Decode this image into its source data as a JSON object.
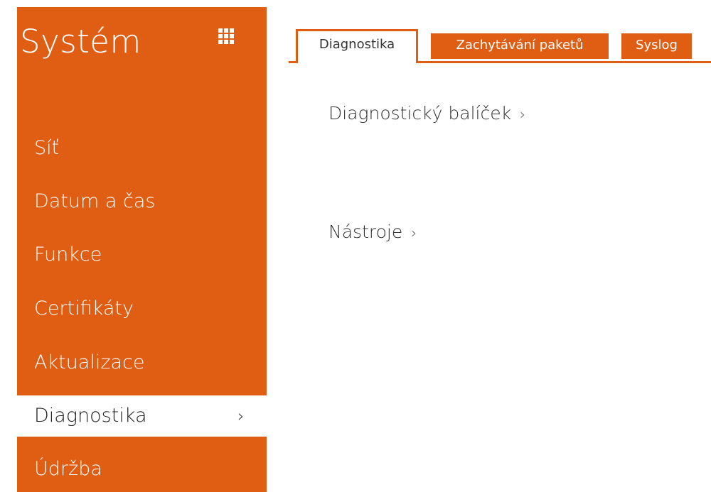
{
  "sidebar": {
    "title": "Systém",
    "items": [
      {
        "label": "Síť"
      },
      {
        "label": "Datum a čas"
      },
      {
        "label": "Funkce"
      },
      {
        "label": "Certifikáty"
      },
      {
        "label": "Aktualizace"
      },
      {
        "label": "Diagnostika",
        "chevron": "›"
      },
      {
        "label": "Údržba"
      }
    ]
  },
  "tabs": [
    {
      "label": "Diagnostika"
    },
    {
      "label": "Zachytávání paketů"
    },
    {
      "label": "Syslog"
    }
  ],
  "main": {
    "sections": [
      {
        "label": "Diagnostický balíček",
        "arrow": "›"
      },
      {
        "label": "Nástroje",
        "arrow": "›"
      }
    ]
  },
  "colors": {
    "accent": "#e05e14",
    "background": "#ffffff",
    "text": "#333333"
  },
  "icons": {
    "apps": "grid-icon",
    "nav_chevron": "chevron-right-icon"
  }
}
